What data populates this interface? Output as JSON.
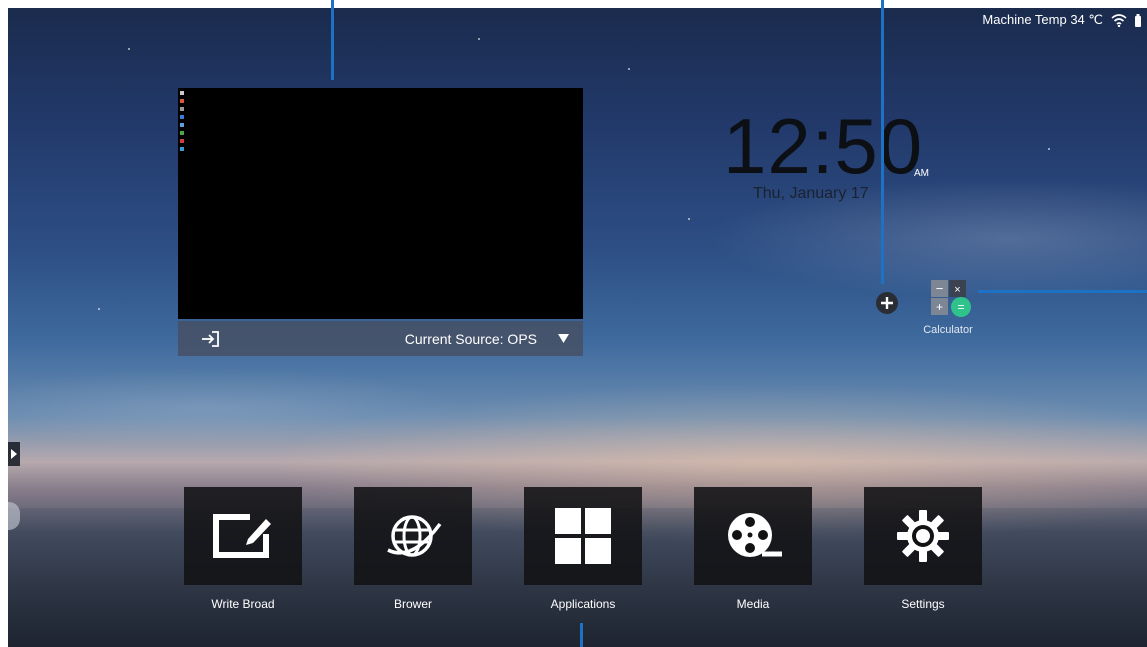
{
  "status_bar": {
    "machine_temp": "Machine Temp 34 ℃",
    "wifi_icon": "wifi-icon",
    "battery_icon": "battery-icon"
  },
  "preview": {
    "source_label": "Current Source:  OPS",
    "enter_icon": "enter-source-icon",
    "dropdown_icon": "triangle-down-icon"
  },
  "clock": {
    "time": "12:50",
    "ampm": "AM",
    "date": "Thu, January 17"
  },
  "widgets": {
    "add_icon": "plus-circle-icon",
    "calculator_label": "Calculator",
    "calculator_symbols": [
      "−",
      "×",
      "+",
      "="
    ]
  },
  "dock": {
    "apps": [
      {
        "label": "Write Broad",
        "icon": "whiteboard-pen-icon"
      },
      {
        "label": "Brower",
        "icon": "globe-icon"
      },
      {
        "label": "Applications",
        "icon": "grid-icon"
      },
      {
        "label": "Media",
        "icon": "film-reel-icon"
      },
      {
        "label": "Settings",
        "icon": "gear-icon"
      }
    ]
  },
  "colors": {
    "guide_line": "#1e72c6",
    "tile_background": "#121214",
    "calculator_accent": "#2fc38b"
  }
}
